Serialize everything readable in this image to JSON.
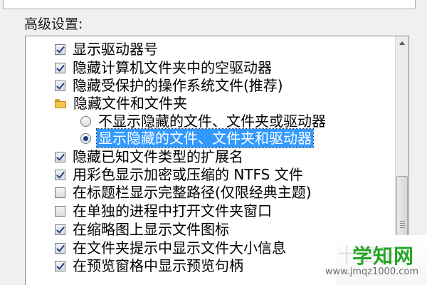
{
  "panel": {
    "title": "高级设置:"
  },
  "items": [
    {
      "type": "checkbox",
      "checked": true,
      "label": "显示驱动器号"
    },
    {
      "type": "checkbox",
      "checked": true,
      "label": "隐藏计算机文件夹中的空驱动器"
    },
    {
      "type": "checkbox",
      "checked": true,
      "label": "隐藏受保护的操作系统文件(推荐)"
    },
    {
      "type": "folder",
      "icon": "folder-icon",
      "label": "隐藏文件和文件夹"
    },
    {
      "type": "radio",
      "selected": false,
      "label": "不显示隐藏的文件、文件夹或驱动器"
    },
    {
      "type": "radio",
      "selected": true,
      "highlighted": true,
      "label": "显示隐藏的文件、文件夹和驱动器"
    },
    {
      "type": "checkbox",
      "checked": true,
      "label": "隐藏已知文件类型的扩展名"
    },
    {
      "type": "checkbox",
      "checked": true,
      "label": "用彩色显示加密或压缩的 NTFS 文件"
    },
    {
      "type": "checkbox",
      "checked": false,
      "label": "在标题栏显示完整路径(仅限经典主题)"
    },
    {
      "type": "checkbox",
      "checked": false,
      "label": "在单独的进程中打开文件夹窗口"
    },
    {
      "type": "checkbox",
      "checked": true,
      "label": "在缩略图上显示文件图标"
    },
    {
      "type": "checkbox",
      "checked": true,
      "label": "在文件夹提示中显示文件大小信息"
    },
    {
      "type": "checkbox",
      "checked": true,
      "label": "在预览窗格中显示预览句柄"
    }
  ],
  "watermark": {
    "logo": "学知网",
    "url": "www.jmqz1000.com"
  },
  "colors": {
    "highlight": "#3399ff",
    "check": "#1f3f8a",
    "watermark_green": "#28a428"
  }
}
